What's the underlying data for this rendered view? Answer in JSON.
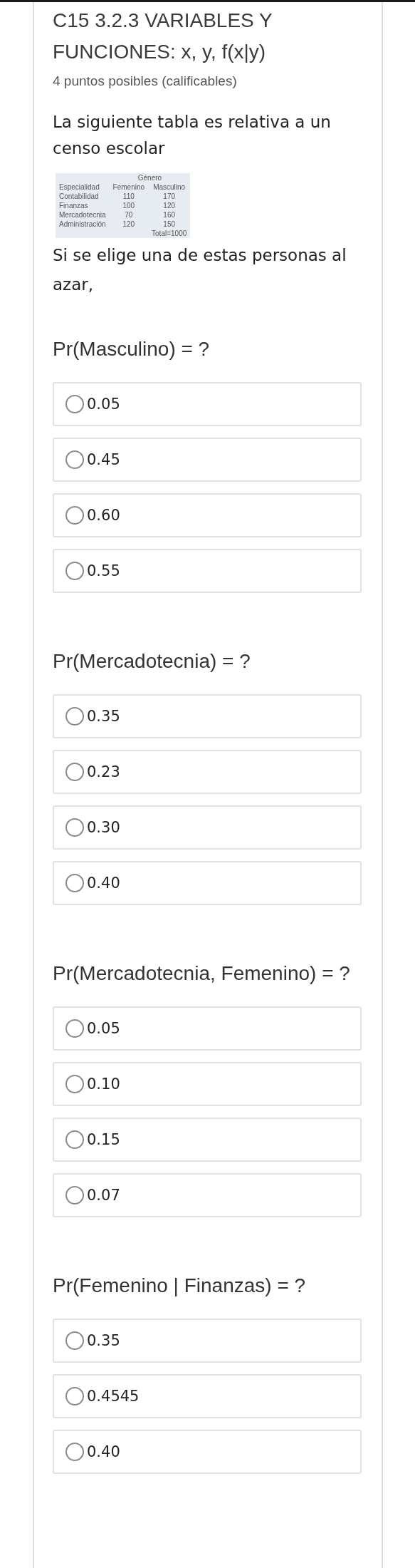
{
  "title": "C15 3.2.3 VARIABLES Y FUNCIONES: x, y, f(x|y)",
  "points": "4 puntos posibles (calificables)",
  "intro": "La siguiente tabla es relativa a un censo escolar",
  "table": {
    "group_header": "Género",
    "columns": [
      "Especialidad",
      "Femenino",
      "Masculino"
    ],
    "rows": [
      [
        "Contabilidad",
        "110",
        "170"
      ],
      [
        "Finanzas",
        "100",
        "120"
      ],
      [
        "Mercadotecnia",
        "70",
        "160"
      ],
      [
        "Administración",
        "120",
        "150"
      ]
    ],
    "total": "Total=1000"
  },
  "prompt": "Si se elige una de estas personas al azar,",
  "questions": [
    {
      "text": "Pr(Masculino) = ?",
      "options": [
        {
          "label": "0.05",
          "selected": false
        },
        {
          "label": "0.45",
          "selected": false
        },
        {
          "label": "0.60",
          "selected": false
        },
        {
          "label": "0.55",
          "selected": false
        }
      ]
    },
    {
      "text": "Pr(Mercadotecnia) = ?",
      "options": [
        {
          "label": "0.35",
          "selected": false
        },
        {
          "label": "0.23",
          "selected": false
        },
        {
          "label": "0.30",
          "selected": false
        },
        {
          "label": "0.40",
          "selected": false
        }
      ]
    },
    {
      "text": "Pr(Mercadotecnia, Femenino) = ?",
      "options": [
        {
          "label": "0.05",
          "selected": false
        },
        {
          "label": "0.10",
          "selected": false
        },
        {
          "label": "0.15",
          "selected": false
        },
        {
          "label": "0.07",
          "selected": false
        }
      ]
    },
    {
      "text": "Pr(Femenino | Finanzas) = ?",
      "options": [
        {
          "label": "0.35",
          "selected": false
        },
        {
          "label": "0.4545",
          "selected": false
        },
        {
          "label": "0.40",
          "selected": false
        }
      ]
    }
  ]
}
